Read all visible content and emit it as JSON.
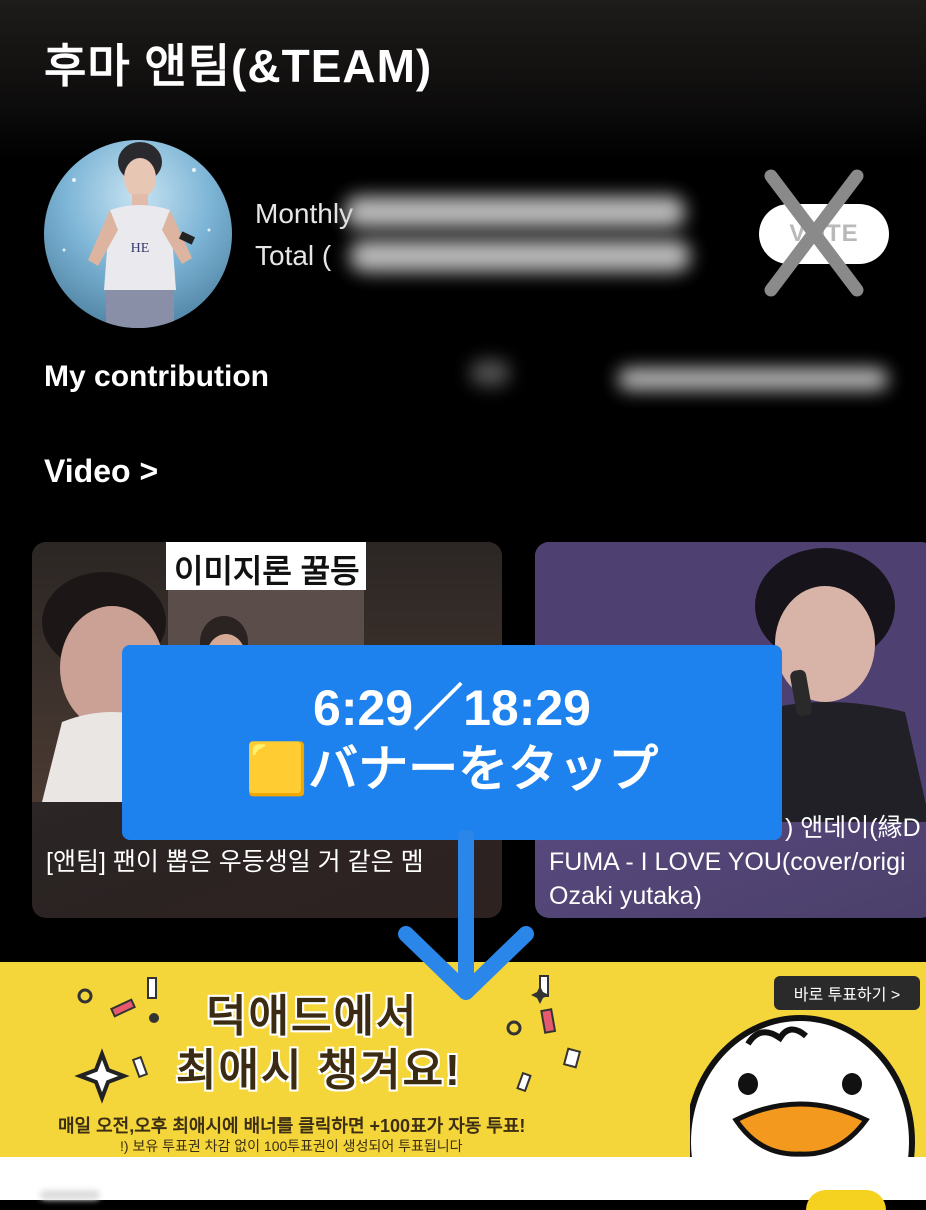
{
  "header": {
    "title": "후마 앤팀(&TEAM)"
  },
  "profile": {
    "monthly_label": "Monthly",
    "total_label": "Total (",
    "vote_label": "VOTE"
  },
  "contribution": {
    "label": "My contribution"
  },
  "video": {
    "section_label": "Video >",
    "cards": [
      {
        "thumb_text": "이미지론 꿀등",
        "caption": "[앤팀] 팬이 뽑은 우등생일 거 같은 멤"
      },
      {
        "caption_line1": ") 앤데이(縁D",
        "caption_line2": "FUMA - I LOVE YOU(cover/origi",
        "caption_line3": "Ozaki yutaka)"
      }
    ]
  },
  "overlay": {
    "time": "6:29／18:29",
    "instruction": "🟨バナーをタップ"
  },
  "ad": {
    "headline1": "덕애드에서",
    "headline2": "최애시 챙겨요!",
    "link_label": "바로 투표하기 >",
    "sub1": "매일 오전,오후 최애시에 배너를 클릭하면 +100표가 자동 투표!",
    "sub2": "!) 보유 투표권 차감 없이 100투표권이 생성되어 투표됩니다"
  },
  "colors": {
    "overlay_blue": "#1d82ee",
    "ad_yellow": "#f5d63a",
    "arrow_blue": "#2a86e8"
  }
}
